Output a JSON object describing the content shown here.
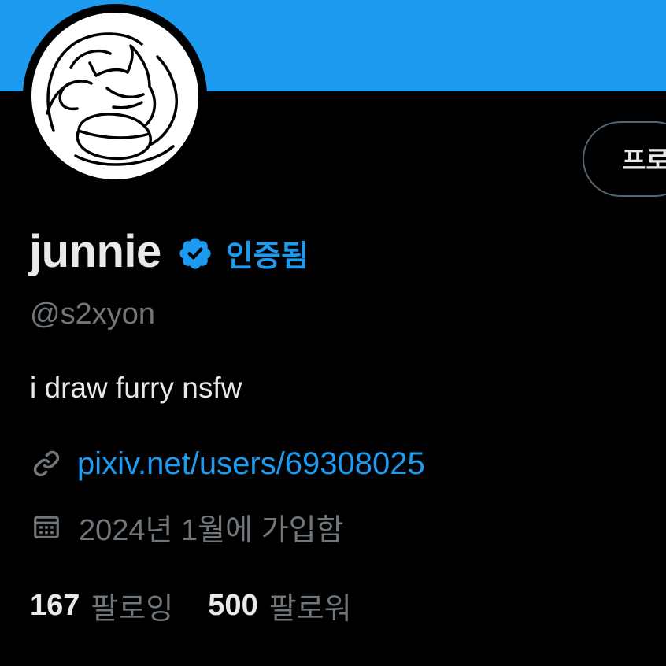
{
  "colors": {
    "banner": "#1d9bf0",
    "background": "#000000",
    "primary_text": "#e7e9ea",
    "secondary_text": "#71767b",
    "accent": "#1d9bf0",
    "button_border": "#536471"
  },
  "header": {
    "edit_profile_label": "프로"
  },
  "profile": {
    "display_name": "junnie",
    "verified_icon": "verified-badge-icon",
    "verified_label": "인증됨",
    "handle": "@s2xyon",
    "bio": "i draw furry nsfw",
    "website": {
      "icon": "link-icon",
      "text": "pixiv.net/users/69308025"
    },
    "joined": {
      "icon": "calendar-icon",
      "text": "2024년 1월에 가입함"
    }
  },
  "stats": {
    "following": {
      "count": "167",
      "label": "팔로잉"
    },
    "followers": {
      "count": "500",
      "label": "팔로워"
    }
  }
}
